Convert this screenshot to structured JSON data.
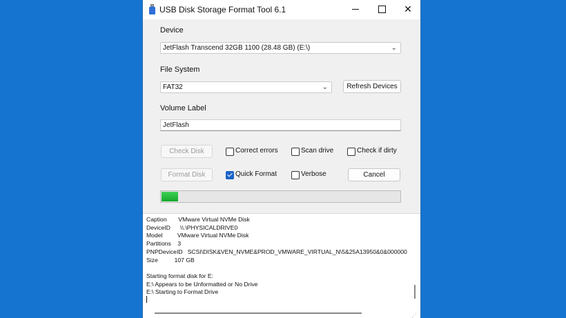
{
  "window": {
    "title": "USB Disk Storage Format Tool 6.1",
    "controls": {
      "minimize": "minimize",
      "maximize": "maximize",
      "close": "✕"
    }
  },
  "device": {
    "label": "Device",
    "selected": "JetFlash  Transcend 32GB  1100 (28.48 GB) (E:\\)"
  },
  "file_system": {
    "label": "File System",
    "selected": "FAT32",
    "refresh_button": "Refresh Devices"
  },
  "volume_label": {
    "label": "Volume Label",
    "value": "JetFlash"
  },
  "actions": {
    "check_disk": "Check Disk",
    "format_disk": "Format Disk",
    "cancel": "Cancel"
  },
  "options": {
    "correct_errors": {
      "label": "Correct errors",
      "checked": false
    },
    "scan_drive": {
      "label": "Scan drive",
      "checked": false
    },
    "check_if_dirty": {
      "label": "Check if dirty",
      "checked": false
    },
    "quick_format": {
      "label": "Quick Format",
      "checked": true
    },
    "verbose": {
      "label": "Verbose",
      "checked": false
    }
  },
  "progress": {
    "fraction": 0.07
  },
  "log": {
    "lines": [
      "Caption       VMware Virtual NVMe Disk",
      "DeviceID      \\\\.\\PHYSICALDRIVE0",
      "Model         VMware Virtual NVMe Disk",
      "Partitions    3",
      "PNPDeviceID   SCSI\\DISK&VEN_NVME&PROD_VMWARE_VIRTUAL_N\\5&25A13950&0&000000",
      "Size          107 GB",
      "",
      "Starting format disk for E:",
      "E:\\ Appears to be Unformatted or No Drive",
      "E:\\ Starting to Format Drive"
    ]
  }
}
